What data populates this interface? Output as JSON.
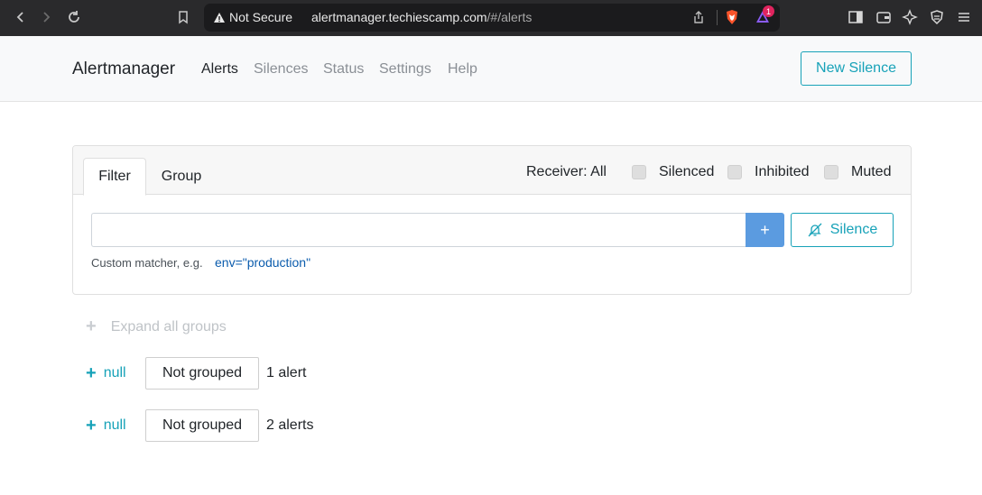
{
  "browser": {
    "security_label": "Not Secure",
    "url_host": "alertmanager.techiescamp.com",
    "url_path": "/#/alerts",
    "rewards_badge": "1"
  },
  "navbar": {
    "brand": "Alertmanager",
    "links": [
      "Alerts",
      "Silences",
      "Status",
      "Settings",
      "Help"
    ],
    "active_link": "Alerts",
    "new_silence_label": "New Silence"
  },
  "filter_card": {
    "tabs": [
      "Filter",
      "Group"
    ],
    "active_tab": "Filter",
    "receiver_label": "Receiver: All",
    "checkboxes": [
      "Silenced",
      "Inhibited",
      "Muted"
    ],
    "input_value": "",
    "add_label": "+",
    "silence_label": "Silence",
    "hint_text": "Custom matcher, e.g.",
    "hint_example": "env=\"production\""
  },
  "groups": {
    "expand_all_label": "Expand all groups",
    "items": [
      {
        "toggle_label": "null",
        "group_label": "Not grouped",
        "count_label": "1 alert"
      },
      {
        "toggle_label": "null",
        "group_label": "Not grouped",
        "count_label": "2 alerts"
      }
    ]
  },
  "colors": {
    "accent": "#17a2b8",
    "add_button": "#5b9be0",
    "link_blue": "#0b5cad"
  }
}
